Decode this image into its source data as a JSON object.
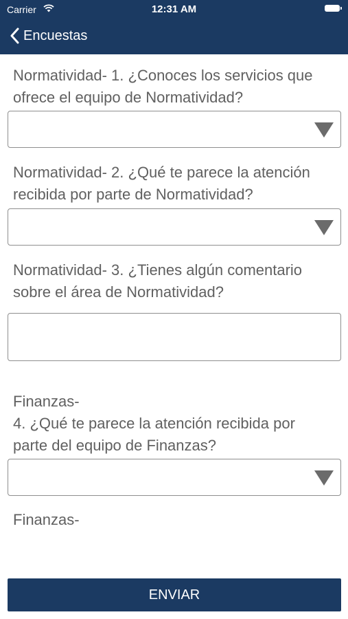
{
  "status_bar": {
    "carrier": "Carrier",
    "time": "12:31 AM"
  },
  "nav": {
    "back_label": "Encuestas"
  },
  "questions": [
    {
      "line1": "Normatividad- 1. ¿Conoces los servicios que",
      "line2": "ofrece el equipo de Normatividad?",
      "type": "select",
      "value": ""
    },
    {
      "line1": "Normatividad- 2. ¿Qué te parece la atención",
      "line2": "recibida por parte de Normatividad?",
      "type": "select",
      "value": ""
    },
    {
      "line1": "Normatividad- 3. ¿Tienes algún comentario",
      "line2": "sobre el área de Normatividad?",
      "type": "text",
      "value": ""
    },
    {
      "line0": "Finanzas-",
      "line1": "4. ¿Qué te parece la atención recibida por",
      "line2": "parte del equipo de Finanzas?",
      "type": "select",
      "value": ""
    },
    {
      "line1": "Finanzas-"
    }
  ],
  "submit_label": "ENVIAR",
  "colors": {
    "header_bg": "#1b3a62",
    "button_bg": "#1b3a62",
    "text": "#606060",
    "border": "#8e8e8e"
  }
}
